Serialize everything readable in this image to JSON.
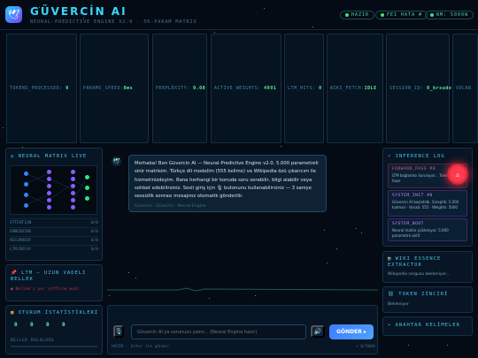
{
  "header": {
    "title": "GÜVERCİN AI",
    "subtitle": "NEURAL-PREDICTIVE ENGINE V2.0 · 5K-PARAM MATRIX",
    "logo_icon": "dove-icon",
    "status": [
      {
        "label": "HAZIR"
      },
      {
        "label": "FEI HATA #"
      },
      {
        "label": "NM: 5000W"
      }
    ]
  },
  "metrics": [
    {
      "label": "TOKENS_PROCESSED:",
      "value": "0"
    },
    {
      "label": "PARAMS_SPEED:",
      "value": "0ms"
    },
    {
      "label": "PERPLEXITY:",
      "value": "0.00"
    },
    {
      "label": "ACTIVE_WEIGHTS:",
      "value": "4991"
    },
    {
      "label": "LTM_HITS:",
      "value": "0"
    },
    {
      "label": "WIKI_FETCH:",
      "value": "IDLE"
    },
    {
      "label": "SESSION_ID:",
      "value": "0_krsudo"
    },
    {
      "label": "VOCAB",
      "value": ""
    }
  ],
  "left": {
    "matrix_title": "◎ NEURAL MATRIX LIVE",
    "matrix_rows": [
      {
        "k": "ATTENTION",
        "v": "0/8"
      },
      {
        "k": "EMBEDDING",
        "v": "0/8"
      },
      {
        "k": "RECURRENT",
        "v": "0/8"
      },
      {
        "k": "LTM/DECAY",
        "v": "0/8"
      }
    ],
    "ltm_title": "LTM — UZUN VADELI BELLEK",
    "ltm_note": "● Bellek'i yer (offline mod)",
    "stats_title": "OTURUM İSTATİSTİKLERİ",
    "stats_values": [
      "0",
      "0",
      "0",
      "0"
    ],
    "memory_label": "BELLEK DOLULUĞU"
  },
  "chat": {
    "avatar_icon": "dove-icon",
    "message": "Merhaba! Ben Güvercin AI — Neural-Predictive Engine v2.0. 5.000 parametreli sinir matrisim. Türkçe dil modelim (555 kelime) ve Wikipedia özü çıkarıcım ile hizmetinizdeyim. Bana herhangi bir konuda soru sorabilir, bilgi alabilir veya sohbet edebilirsiniz. Sesli giriş için 🎙 butonunu kullanabilirsiniz — 3 saniye sessizlik sonrası mesajınız otomatik gönderilir.",
    "message_meta": "Güvercin · Güvercin · Neural Engine",
    "input_placeholder": "Güvercin AI ya sorunuzu yazın... (Neural Engine hazır)",
    "mic_icon": "microphone-icon",
    "speaker_icon": "speaker-icon",
    "send_label": "GÖNDER ▸",
    "footer_left": "HAZIR · Enter ile gönder",
    "footer_right": "• 0/5000"
  },
  "right": {
    "log_title": "⚡ INFERENCE LOG",
    "log_items": [
      {
        "head": "FORWARD_PASS #0",
        "body": "LTM bağlantısı kuruluyor... Tokenizer hazır",
        "color": "#e8567a"
      },
      {
        "head": "SYSTEM_INIT #0",
        "body": "Güvercin AI başlatıldı. Sinaptik: 5.000 katman · Vocab: 555 · Weights: 5000",
        "color": "#c58cff"
      },
      {
        "head": "SYSTEM_BOOT",
        "body": "Neural matrix yükleniyor: 5.000 parametre aktif",
        "color": "#c58cff"
      }
    ],
    "wiki_title": "WIKI ESSENCE EXTRACTOR",
    "wiki_note": "Wikipedia sorgusu bekleniyor...",
    "token_title": "TOKEN ZİNCİRİ",
    "token_note": "Bekleniyor",
    "keywords_title": "ANAHTAR KELİMELER",
    "alert_icon": "warning-icon"
  },
  "colors": {
    "accent": "#39d8ff",
    "send": "#4a8dff",
    "alert": "#ff3a4c",
    "ok": "#2ee67a"
  }
}
